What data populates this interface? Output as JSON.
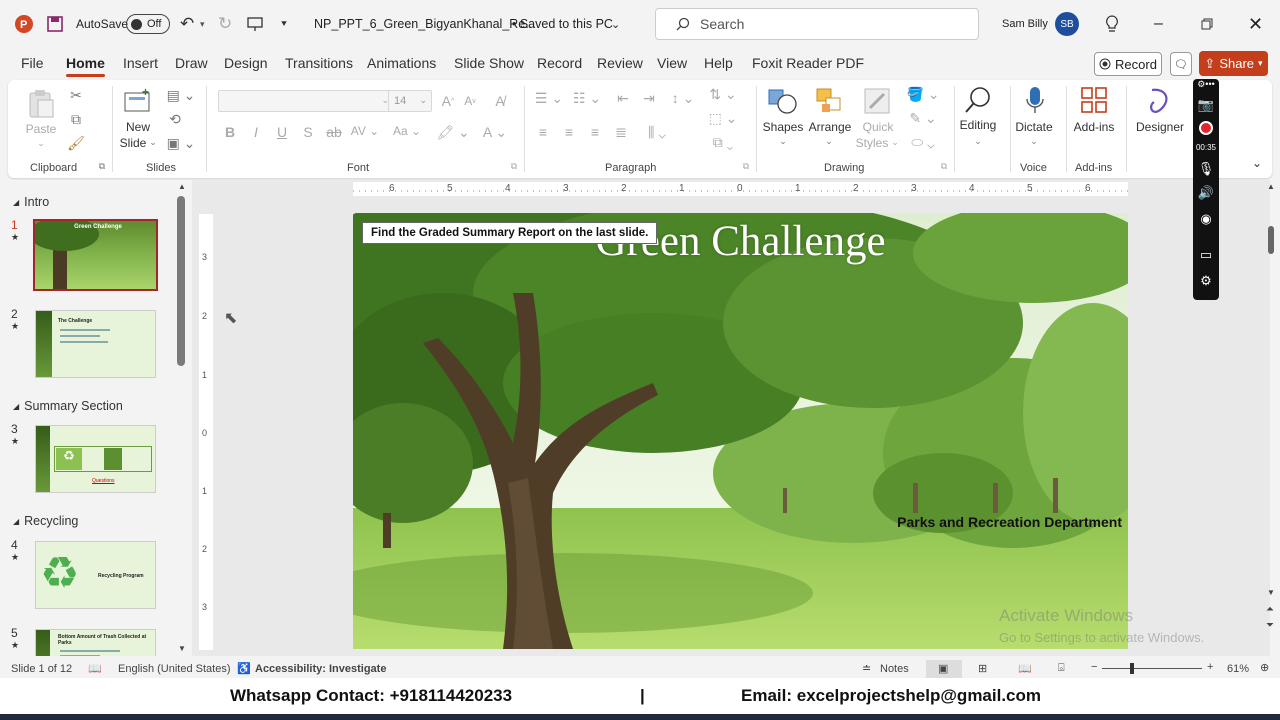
{
  "titlebar": {
    "autosave_label": "AutoSave",
    "autosave_state": "Off",
    "filename": "NP_PPT_6_Green_BigyanKhanal_Re...",
    "save_status": "• Saved to this PC",
    "search_placeholder": "Search",
    "user_name": "Sam Billy",
    "user_initials": "SB"
  },
  "tabs": [
    "File",
    "Home",
    "Insert",
    "Draw",
    "Design",
    "Transitions",
    "Animations",
    "Slide Show",
    "Record",
    "Review",
    "View",
    "Help",
    "Foxit Reader PDF"
  ],
  "active_tab": "Home",
  "record_button": "Record",
  "share_button": "Share",
  "ribbon": {
    "clipboard": {
      "paste": "Paste",
      "label": "Clipboard"
    },
    "slides": {
      "new_slide_line1": "New",
      "new_slide_line2": "Slide",
      "label": "Slides"
    },
    "font": {
      "size": "14",
      "label": "Font"
    },
    "paragraph": {
      "label": "Paragraph"
    },
    "drawing": {
      "shapes": "Shapes",
      "arrange": "Arrange",
      "quick_styles_line1": "Quick",
      "quick_styles_line2": "Styles",
      "label": "Drawing"
    },
    "editing": {
      "label": "Editing"
    },
    "voice": {
      "dictate": "Dictate",
      "label": "Voice"
    },
    "addins": {
      "addins": "Add-ins",
      "label": "Add-ins"
    },
    "designer": {
      "label": "Designer"
    }
  },
  "slide_panel": {
    "sections": [
      "Intro",
      "Summary Section",
      "Recycling"
    ],
    "slides": [
      {
        "num": "1",
        "title": "Green Challenge"
      },
      {
        "num": "2",
        "title": "The Challenge"
      },
      {
        "num": "3",
        "title": "Questions"
      },
      {
        "num": "4",
        "title": "Recycling Program"
      },
      {
        "num": "5",
        "title": "Bottom Amount of Trash Collected at Parks"
      }
    ]
  },
  "ruler": {
    "h_ticks": [
      "6",
      "5",
      "4",
      "3",
      "2",
      "1",
      "0",
      "1",
      "2",
      "3",
      "4",
      "5",
      "6"
    ],
    "v_ticks": [
      "3",
      "2",
      "1",
      "0",
      "1",
      "2",
      "3"
    ]
  },
  "slide": {
    "title": "Green Challenge",
    "note": "Find the Graded Summary Report on the last slide.",
    "subtitle": "Parks and Recreation Department"
  },
  "watermark": {
    "line1": "Activate Windows",
    "line2": "Go to Settings to activate Windows."
  },
  "recorder": {
    "time": "00:35"
  },
  "statusbar": {
    "slide_info": "Slide 1 of 12",
    "language": "English (United States)",
    "accessibility": "Accessibility: Investigate",
    "notes": "Notes",
    "zoom": "61%"
  },
  "footer": {
    "whatsapp": "Whatsapp Contact: +918114420233",
    "separator": "|",
    "email": "Email: excelprojectshelp@gmail.com"
  },
  "colors": {
    "accent": "#c43e1c",
    "selected_thumb": "#a4262c",
    "avatar": "#1f4e9c"
  }
}
